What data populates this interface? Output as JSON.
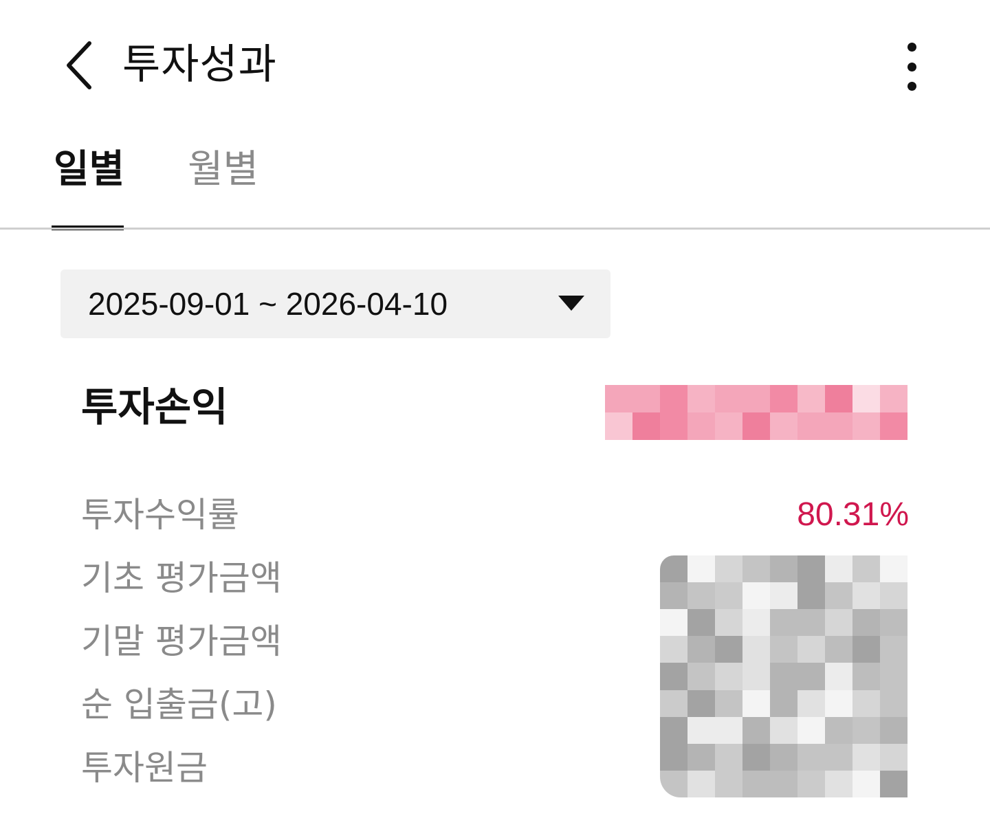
{
  "header": {
    "title": "투자성과",
    "back_icon": "chevron-left-icon",
    "more_icon": "more-vertical-icon"
  },
  "tabs": [
    {
      "label": "일별",
      "active": true
    },
    {
      "label": "월별",
      "active": false
    }
  ],
  "date_range": {
    "value": "2025-09-01 ~ 2026-04-10",
    "caret_icon": "caret-down-icon"
  },
  "summary": {
    "profit_label": "투자손익",
    "rows": [
      {
        "label": "투자수익률",
        "value": "80.31%"
      },
      {
        "label": "기초 평가금액"
      },
      {
        "label": "기말 평가금액"
      },
      {
        "label": "순 입출금(고)"
      },
      {
        "label": "투자원금"
      }
    ]
  },
  "colors": {
    "accent_red": "#d0174e",
    "tab_active": "#111111",
    "tab_inactive": "#8a8a8a",
    "select_bg": "#f1f1f1"
  }
}
